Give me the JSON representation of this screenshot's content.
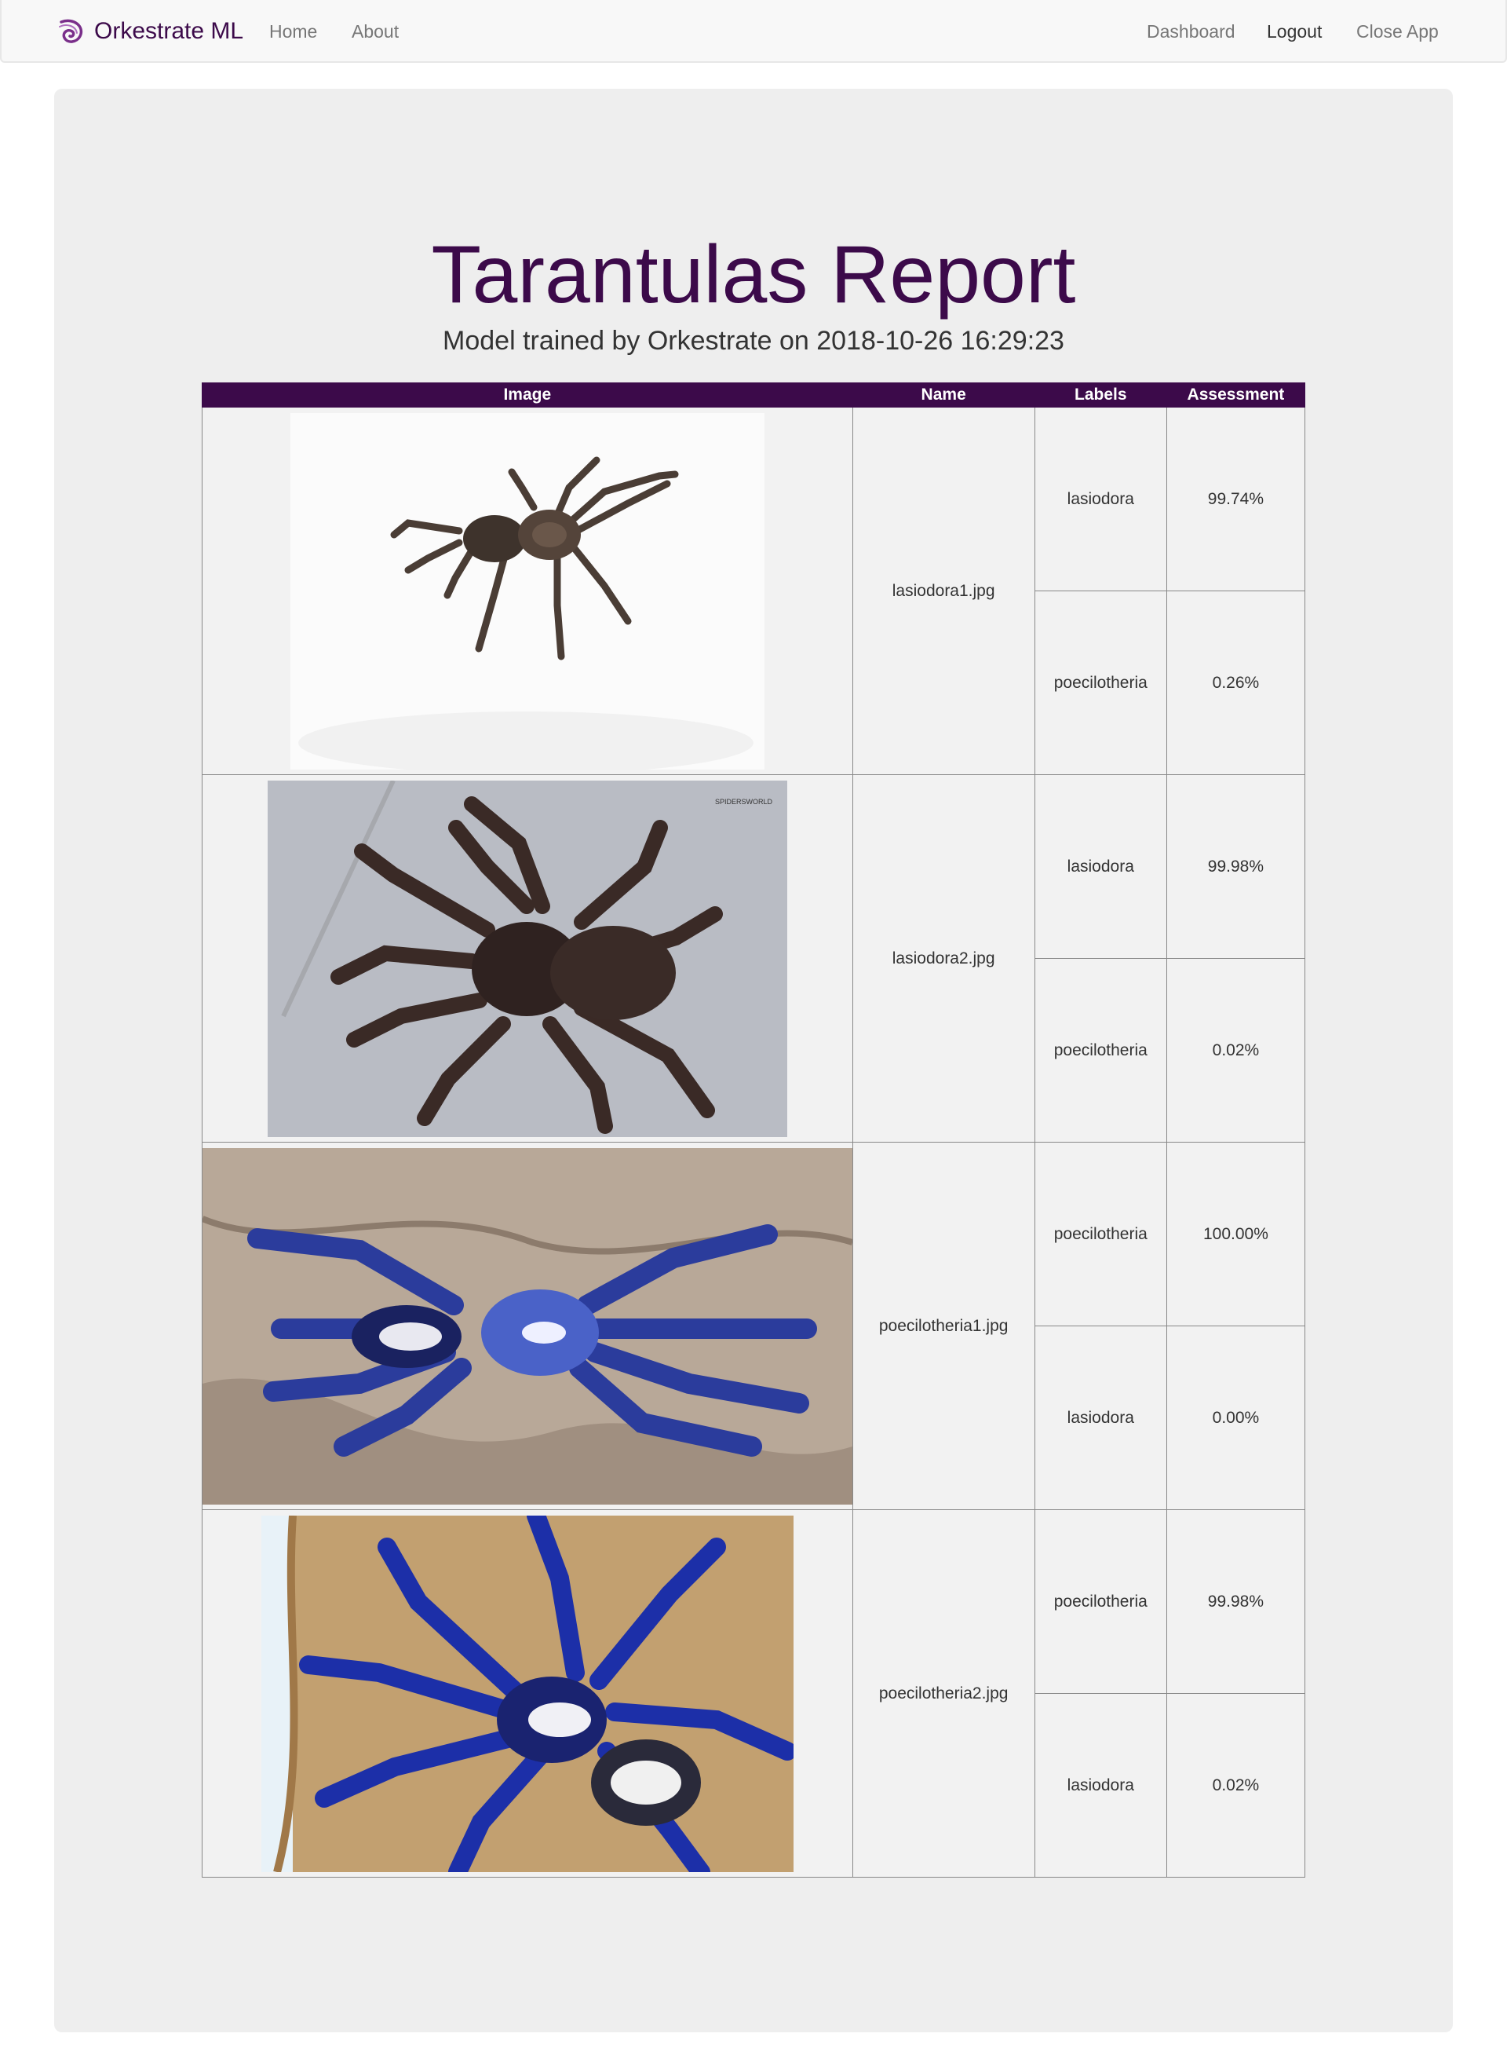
{
  "navbar": {
    "brand": "Orkestrate ML",
    "brand_icon": "orkestrate-logo-icon",
    "brand_color": "#3c0a4a",
    "links_left": [
      "Home",
      "About"
    ],
    "links_right": [
      "Dashboard",
      "Logout",
      "Close App"
    ]
  },
  "report": {
    "title": "Tarantulas Report",
    "subtitle": "Model trained by Orkestrate on 2018-10-26 16:29:23",
    "header_color": "#3c0a4a",
    "columns": [
      "Image",
      "Name",
      "Labels",
      "Assessment"
    ],
    "rows": [
      {
        "name": "lasiodora1.jpg",
        "image_desc": "brown tarantula on white background",
        "predictions": [
          {
            "label": "lasiodora",
            "assessment": "99.74%"
          },
          {
            "label": "poecilotheria",
            "assessment": "0.26%"
          }
        ]
      },
      {
        "name": "lasiodora2.jpg",
        "image_desc": "dark hairy tarantula on grey concrete",
        "predictions": [
          {
            "label": "lasiodora",
            "assessment": "99.98%"
          },
          {
            "label": "poecilotheria",
            "assessment": "0.02%"
          }
        ]
      },
      {
        "name": "poecilotheria1.jpg",
        "image_desc": "blue tarantula on rock",
        "predictions": [
          {
            "label": "poecilotheria",
            "assessment": "100.00%"
          },
          {
            "label": "lasiodora",
            "assessment": "0.00%"
          }
        ]
      },
      {
        "name": "poecilotheria2.jpg",
        "image_desc": "blue tarantula on cork bark",
        "predictions": [
          {
            "label": "poecilotheria",
            "assessment": "99.98%"
          },
          {
            "label": "lasiodora",
            "assessment": "0.02%"
          }
        ]
      }
    ]
  }
}
